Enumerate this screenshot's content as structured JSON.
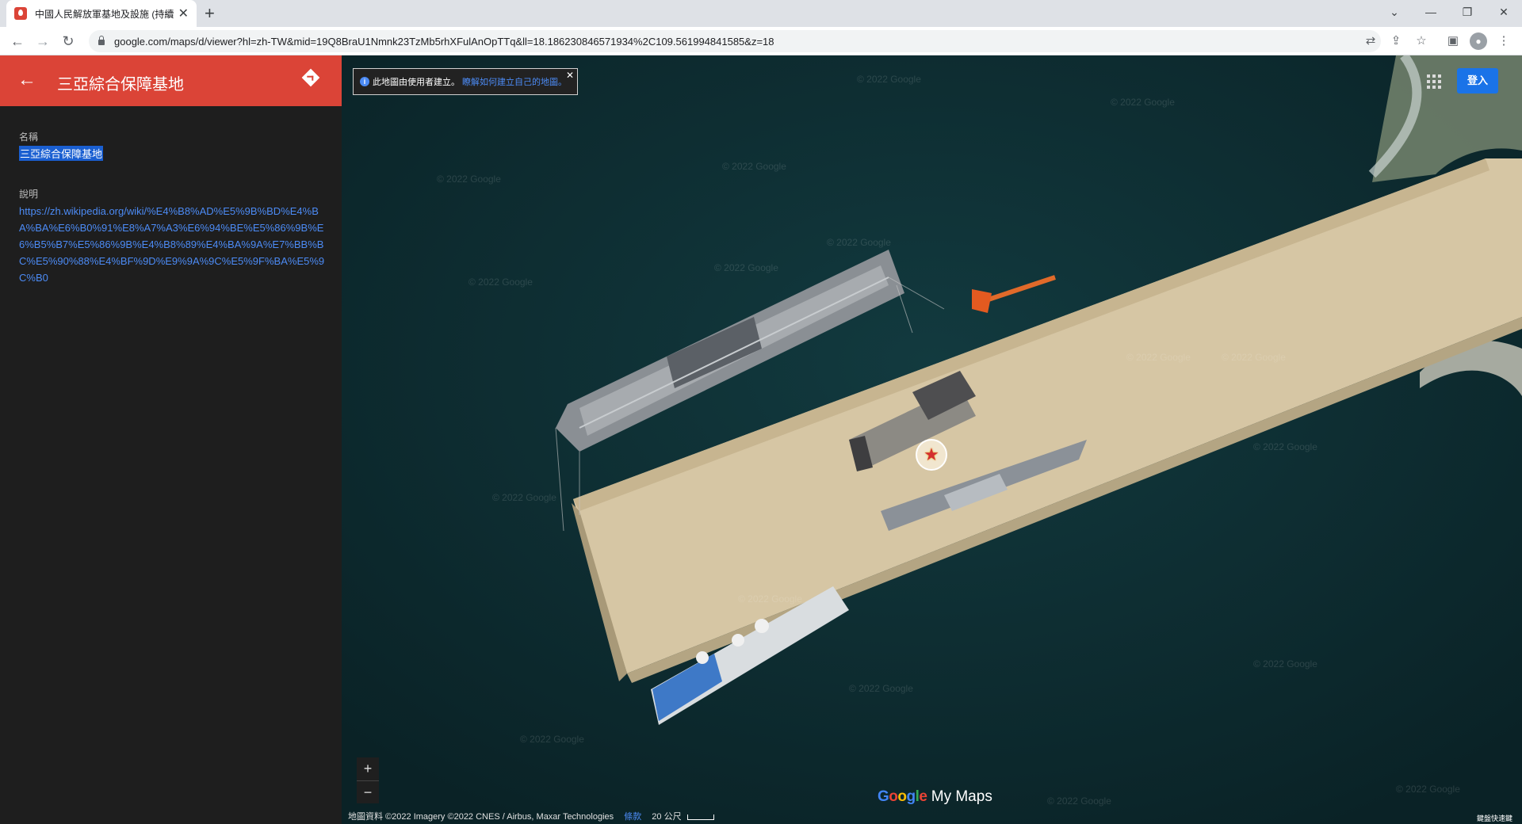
{
  "browser": {
    "tab_title": "中國人民解放軍基地及設施 (持續...",
    "tab_close": "✕",
    "new_tab": "+",
    "url": "google.com/maps/d/viewer?hl=zh-TW&mid=19Q8BraU1Nmnk23TzMb5rhXFulAnOpTTq&ll=18.186230846571934%2C109.561994841585&z=18",
    "window_controls": [
      "⌄",
      "—",
      "❐",
      "✕"
    ]
  },
  "panel": {
    "title": "三亞綜合保障基地",
    "name_label": "名稱",
    "name_value": "三亞綜合保障基地",
    "desc_label": "說明",
    "desc_link": "https://zh.wikipedia.org/wiki/%E4%B8%AD%E5%9B%BD%E4%BA%BA%E6%B0%91%E8%A7%A3%E6%94%BE%E5%86%9B%E6%B5%B7%E5%86%9B%E4%B8%89%E4%BA%9A%E7%BB%BC%E5%90%88%E4%BF%9D%E9%9A%9C%E5%9F%BA%E5%9C%B0"
  },
  "map": {
    "notice_text": "此地圖由使用者建立。",
    "notice_link": "瞭解如何建立自己的地圖。",
    "signin": "登入",
    "zoom_in": "+",
    "zoom_out": "−",
    "logo_google": [
      "G",
      "o",
      "o",
      "g",
      "l",
      "e"
    ],
    "logo_mymaps": "My Maps",
    "attribution": "地圖資料 ©2022 Imagery ©2022 CNES / Airbus, Maxar Technologies",
    "terms": "條款",
    "scale": "20 公尺",
    "shortcuts": "鍵盤快速鍵",
    "watermark": "© 2022 Google",
    "marker_icon": "star-marker-icon",
    "colors": {
      "sea": "#0d2b30",
      "pier": "#d4c4a3",
      "header": "#db4437",
      "link": "#4c8bf5"
    }
  }
}
